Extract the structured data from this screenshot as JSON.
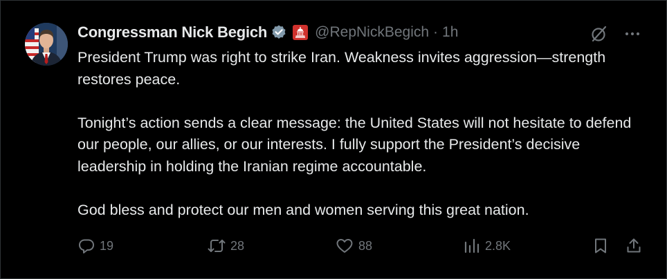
{
  "author": {
    "display_name": "Congressman Nick Begich",
    "handle": "@RepNickBegich",
    "separator": "·",
    "time": "1h"
  },
  "body": {
    "paragraph_1": "President Trump was right to strike Iran. Weakness invites aggression—strength restores peace.",
    "paragraph_2": "Tonight’s action sends a clear message: the United States will not hesitate to defend our people, our allies, or our interests. I fully support the President’s decisive leadership in holding the Iranian regime accountable.",
    "paragraph_3": "God bless and protect our men and women serving this great nation."
  },
  "actions": {
    "replies": "19",
    "reposts": "28",
    "likes": "88",
    "views": "2.8K"
  },
  "icons": {
    "verified": "verified-badge-icon",
    "affiliate": "capitol-affiliate-icon",
    "grok": "grok-icon",
    "more": "more-icon",
    "reply": "reply-icon",
    "repost": "repost-icon",
    "like": "heart-icon",
    "views": "views-icon",
    "bookmark": "bookmark-icon",
    "share": "share-icon"
  },
  "colors": {
    "background": "#000000",
    "text_primary": "#e7e9ea",
    "text_secondary": "#71767b",
    "border": "#2f3336",
    "verified_badge": "#829aab",
    "affiliate_badge": "#d0312d"
  }
}
